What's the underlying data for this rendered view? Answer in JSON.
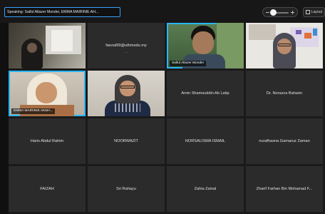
{
  "topbar": {
    "speaking_text": "Speaking: Saiful Allazer Mondei, EMMA MAIRINIE AH...",
    "layout_label": "Layout"
  },
  "tiles": [
    {
      "type": "video",
      "scene": "v1",
      "name": "",
      "caption": "",
      "active": false
    },
    {
      "type": "name",
      "name": "faezal99@uthmedu.my",
      "sub": "...",
      "active": false
    },
    {
      "type": "video",
      "scene": "v3",
      "name": "",
      "caption": "Saiful Allazer Mondei",
      "active": true
    },
    {
      "type": "video",
      "scene": "v4",
      "name": "",
      "caption": "",
      "active": false
    },
    {
      "type": "video",
      "scene": "v5",
      "name": "",
      "caption": "EMMA MAIRINIE AKMA...",
      "active": true
    },
    {
      "type": "video",
      "scene": "v6",
      "name": "",
      "caption": "",
      "active": false
    },
    {
      "type": "name",
      "name": "Amin Shamsuddin Ab Latip",
      "active": false
    },
    {
      "type": "name",
      "name": "Dr. Norazza Baharin",
      "active": false
    },
    {
      "type": "name",
      "name": "Haris Abdul Rahim",
      "active": false
    },
    {
      "type": "name",
      "name": "NOORWAZIT",
      "active": false
    },
    {
      "type": "name",
      "name": "NORSALISMA ISMAIL",
      "active": false
    },
    {
      "type": "name",
      "name": "nurafhasna Gamaruz Zaman",
      "active": false
    },
    {
      "type": "name",
      "name": "FAIZAH",
      "active": false
    },
    {
      "type": "name",
      "name": "Sri Rahayu",
      "active": false
    },
    {
      "type": "name",
      "name": "Zahia Zainal",
      "active": false
    },
    {
      "type": "name",
      "name": "Zharif Farhan Bin Mohamad F...",
      "active": false
    }
  ],
  "colors": {
    "active_border": "#29b6f6",
    "tile_bg": "#2b2b2b",
    "page_bg": "#1a1a1a"
  }
}
